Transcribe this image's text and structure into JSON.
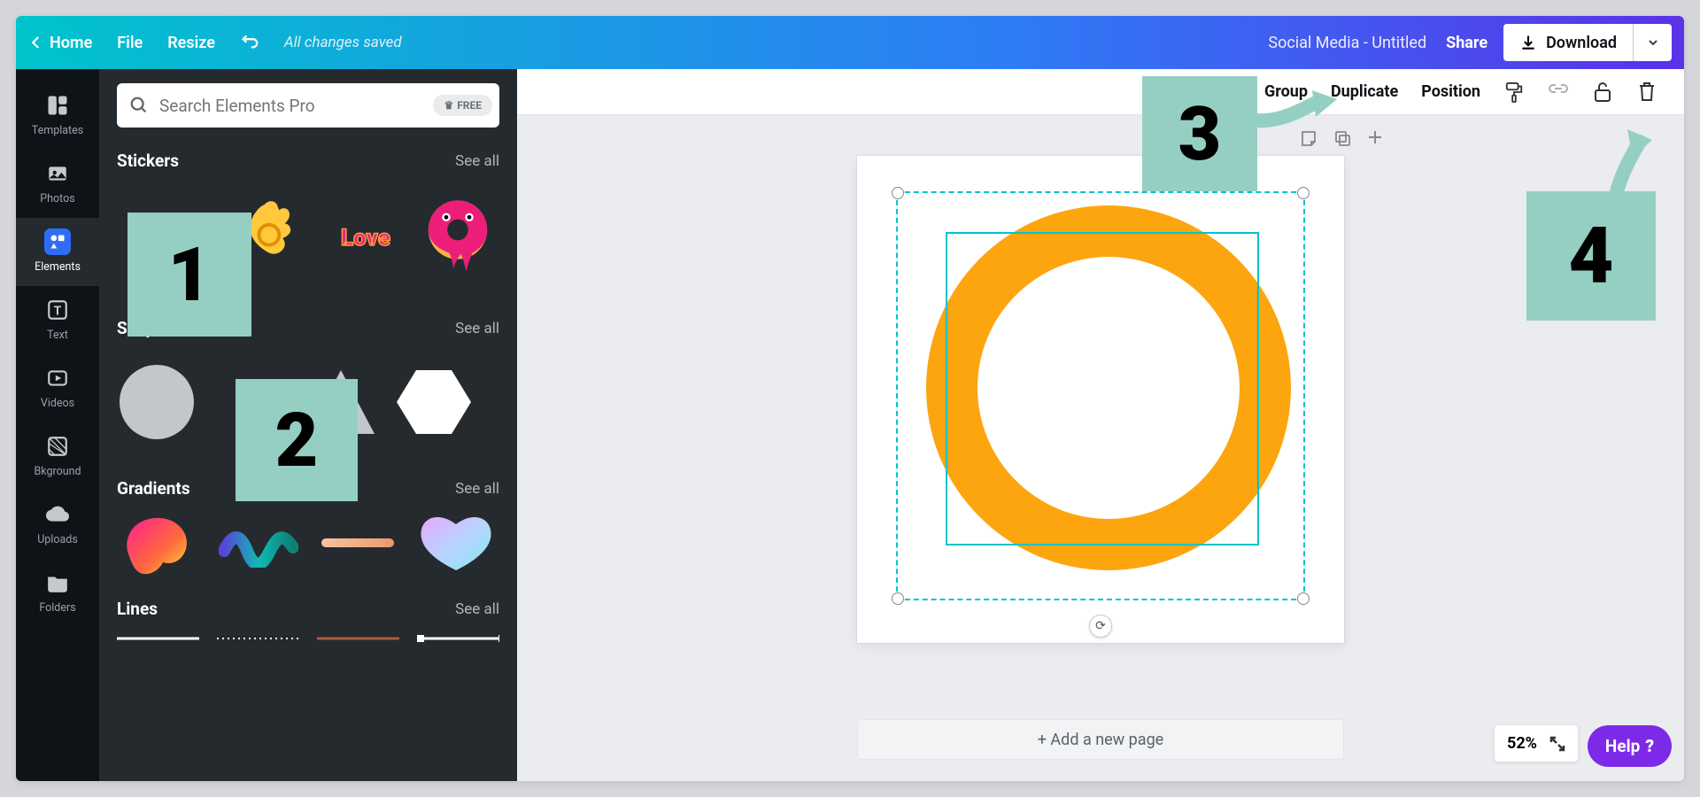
{
  "topbar": {
    "home": "Home",
    "file": "File",
    "resize": "Resize",
    "saved": "All changes saved",
    "doc_title": "Social Media - Untitled",
    "share": "Share",
    "download": "Download"
  },
  "nav": {
    "templates": "Templates",
    "photos": "Photos",
    "elements": "Elements",
    "text": "Text",
    "videos": "Videos",
    "bkground": "Bkground",
    "uploads": "Uploads",
    "folders": "Folders"
  },
  "panel": {
    "search_placeholder": "Search Elements Pro",
    "free_badge": "FREE",
    "stickers": {
      "title": "Stickers",
      "see_all": "See all"
    },
    "shapes": {
      "title": "Shapes",
      "see_all": "See all"
    },
    "gradients": {
      "title": "Gradients",
      "see_all": "See all"
    },
    "lines": {
      "title": "Lines",
      "see_all": "See all"
    },
    "sticker_love": "Love"
  },
  "context": {
    "group": "Group",
    "duplicate": "Duplicate",
    "position": "Position"
  },
  "stage": {
    "add_page": "+ Add a new page",
    "zoom": "52%",
    "help": "Help"
  },
  "annotations": {
    "a1": "1",
    "a2": "2",
    "a3": "3",
    "a4": "4"
  }
}
